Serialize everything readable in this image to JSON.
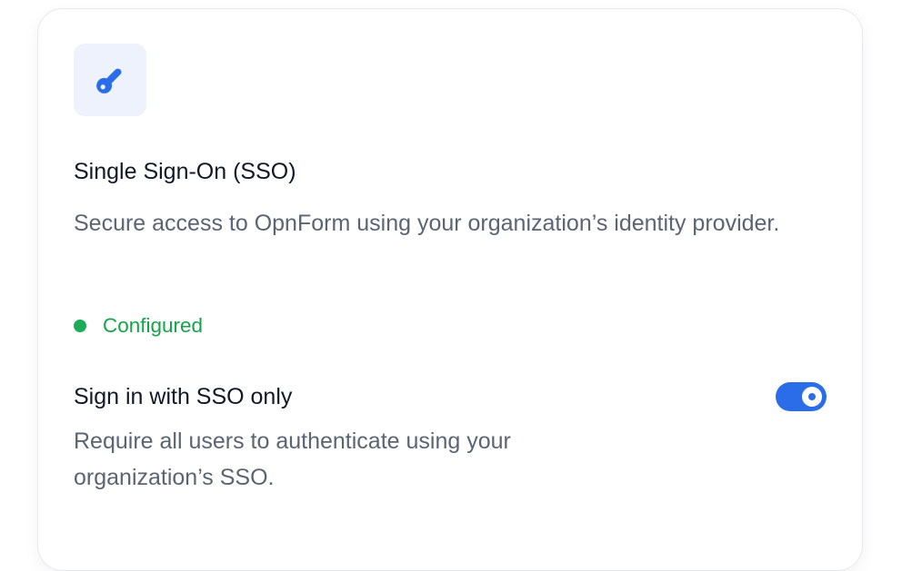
{
  "card": {
    "icon": "key-icon",
    "title": "Single Sign-On (SSO)",
    "description": "Secure access to OpnForm using your organization’s identity provider.",
    "status": {
      "label": "Configured",
      "color": "#16a34a"
    },
    "option": {
      "label": "Sign in with SSO only",
      "description": "Require all users to authenticate using your organization’s SSO.",
      "enabled": true
    }
  },
  "colors": {
    "accent": "#2b6de8",
    "icon_bg": "#edf2fd",
    "success": "#16a34a"
  }
}
